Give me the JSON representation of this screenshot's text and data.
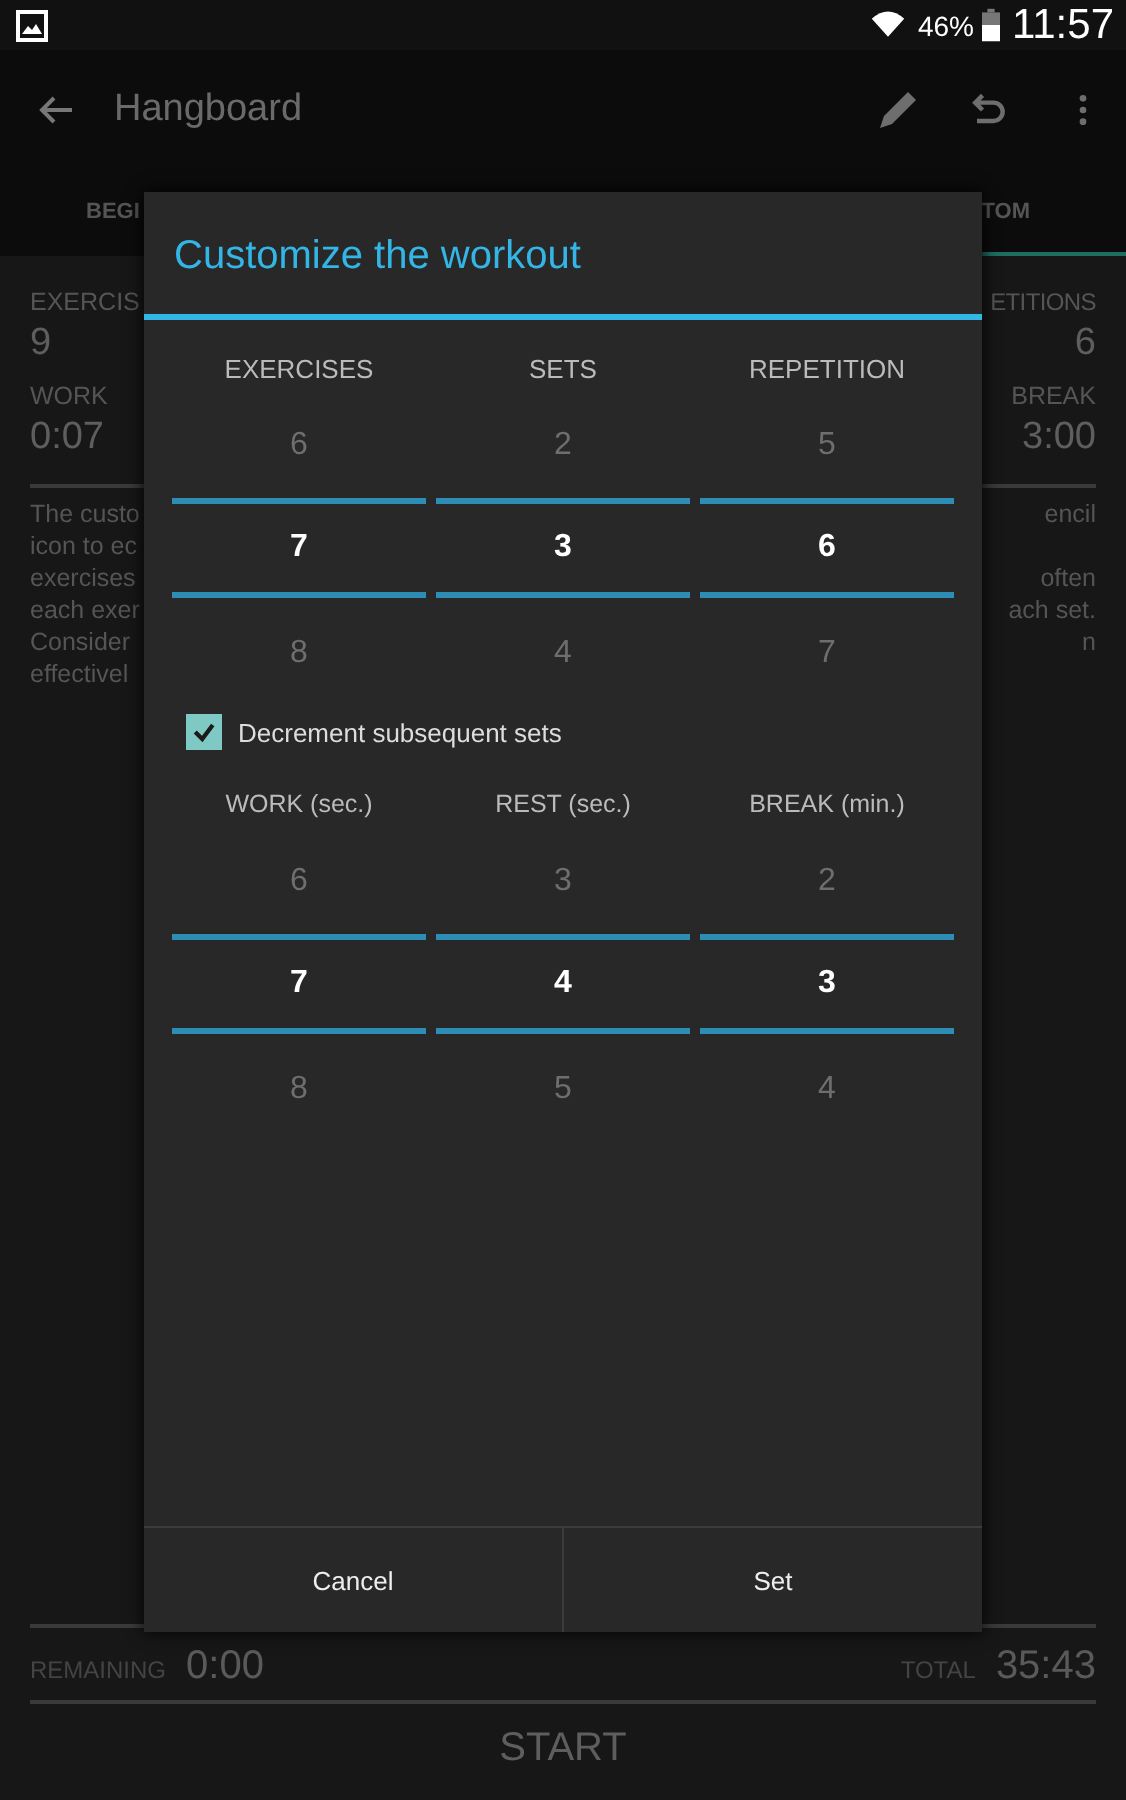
{
  "status_bar": {
    "battery_percent": "46%",
    "time": "11:57"
  },
  "app_bar": {
    "title": "Hangboard"
  },
  "tabs": [
    {
      "label": "BEGI",
      "selected": false
    },
    {
      "label": "TOM",
      "selected": true
    }
  ],
  "stats_left": [
    {
      "label": "EXERCIS",
      "value": "9"
    },
    {
      "label": "WORK",
      "value": "0:07"
    }
  ],
  "stats_right": [
    {
      "label": "ETITIONS",
      "value": "6"
    },
    {
      "label": "BREAK",
      "value": "3:00"
    }
  ],
  "description": [
    {
      "left": "The custo",
      "right": "encil"
    },
    {
      "left": "icon to ec"
    },
    {
      "left": "exercises",
      "right": "often"
    },
    {
      "left": "each exer",
      "right": "ach set."
    },
    {
      "left": "Consider",
      "right": "n"
    },
    {
      "left": "effectivel"
    }
  ],
  "footer": {
    "remaining_label": "REMAINING",
    "remaining_value": "0:00",
    "total_label": "TOTAL",
    "total_value": "35:43",
    "start": "START"
  },
  "dialog": {
    "title": "Customize the workout",
    "pickers": [
      {
        "label": "EXERCISES",
        "above": "6",
        "value": "7",
        "below": "8"
      },
      {
        "label": "SETS",
        "above": "2",
        "value": "3",
        "below": "4"
      },
      {
        "label": "REPETITION",
        "above": "5",
        "value": "6",
        "below": "7"
      }
    ],
    "decrement": {
      "label": "Decrement subsequent sets",
      "checked": true
    },
    "timers": [
      {
        "label": "WORK (sec.)",
        "above": "6",
        "value": "7",
        "below": "8"
      },
      {
        "label": "REST (sec.)",
        "above": "3",
        "value": "4",
        "below": "5"
      },
      {
        "label": "BREAK (min.)",
        "above": "2",
        "value": "3",
        "below": "4"
      }
    ],
    "buttons": [
      "Cancel",
      "Set"
    ]
  }
}
